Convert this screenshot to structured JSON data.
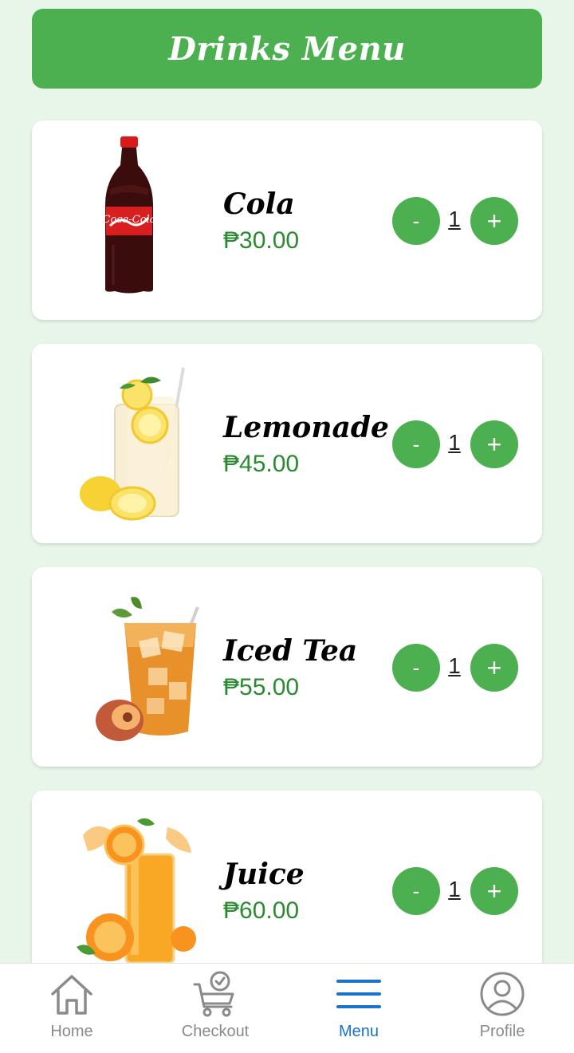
{
  "header": {
    "title": "Drinks Menu"
  },
  "colors": {
    "primary": "#4caf50",
    "price": "#2a8a2f",
    "background": "#e7f6e8",
    "active_nav": "#1a73c9",
    "inactive_nav": "#8a8a8a"
  },
  "drinks": [
    {
      "name": "Cola",
      "price": "₱30.00",
      "quantity": "1",
      "minus": "-",
      "plus": "+",
      "image_icon": "cola-bottle-image"
    },
    {
      "name": "Lemonade",
      "price": "₱45.00",
      "quantity": "1",
      "minus": "-",
      "plus": "+",
      "image_icon": "lemonade-glass-image"
    },
    {
      "name": "Iced Tea",
      "price": "₱55.00",
      "quantity": "1",
      "minus": "-",
      "plus": "+",
      "image_icon": "iced-tea-glass-image"
    },
    {
      "name": "Juice",
      "price": "₱60.00",
      "quantity": "1",
      "minus": "-",
      "plus": "+",
      "image_icon": "orange-juice-image"
    }
  ],
  "nav": {
    "items": [
      {
        "label": "Home",
        "icon": "home-icon",
        "active": false
      },
      {
        "label": "Checkout",
        "icon": "cart-check-icon",
        "active": false
      },
      {
        "label": "Menu",
        "icon": "menu-icon",
        "active": true
      },
      {
        "label": "Profile",
        "icon": "profile-icon",
        "active": false
      }
    ]
  }
}
